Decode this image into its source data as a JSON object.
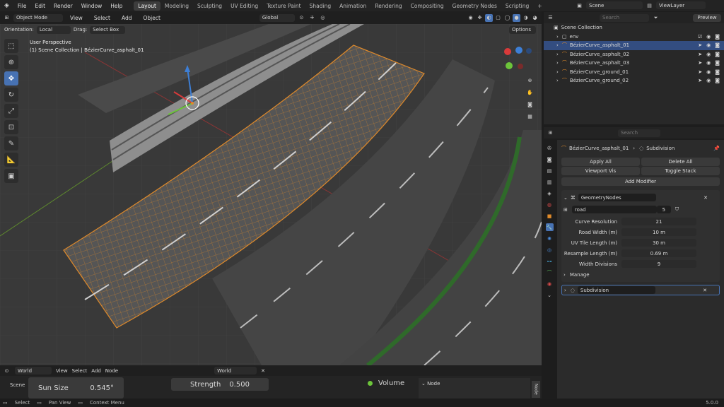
{
  "menu": {
    "file": "File",
    "edit": "Edit",
    "render": "Render",
    "window": "Window",
    "help": "Help"
  },
  "workspaces": [
    "Layout",
    "Modeling",
    "Sculpting",
    "UV Editing",
    "Texture Paint",
    "Shading",
    "Animation",
    "Rendering",
    "Compositing",
    "Geometry Nodes",
    "Scripting"
  ],
  "top_right": {
    "scene": "Scene",
    "view_layer": "ViewLayer"
  },
  "viewport_header": {
    "mode": "Object Mode",
    "view": "View",
    "select": "Select",
    "add": "Add",
    "object": "Object",
    "transform": "Global"
  },
  "sub_header": {
    "orientation_label": "Orientation:",
    "orientation": "Local",
    "drag_label": "Drag:",
    "drag": "Select Box",
    "options": "Options"
  },
  "overlay": {
    "perspective": "User Perspective",
    "collection": "(1) Scene Collection | BézierCurve_asphalt_01"
  },
  "outliner": {
    "search_placeholder": "Search",
    "preview": "Preview",
    "root": "Scene Collection",
    "items": [
      {
        "name": "env",
        "selected": false
      },
      {
        "name": "BézierCurve_asphalt_01",
        "selected": true
      },
      {
        "name": "BézierCurve_asphalt_02",
        "selected": false
      },
      {
        "name": "BézierCurve_asphalt_03",
        "selected": false
      },
      {
        "name": "BézierCurve_ground_01",
        "selected": false
      },
      {
        "name": "BézierCurve_ground_02",
        "selected": false
      }
    ]
  },
  "properties": {
    "search_placeholder": "Search",
    "object_name": "BézierCurve_asphalt_01",
    "tab": "Subdivision",
    "apply_all": "Apply All",
    "delete_all": "Delete All",
    "viewport_vis": "Viewport Vis",
    "toggle_stack": "Toggle Stack",
    "add_modifier": "Add Modifier",
    "gn_modifier": "GeometryNodes",
    "node_group": "road",
    "node_group_users": "5",
    "params": [
      {
        "label": "Curve Resolution",
        "value": "21"
      },
      {
        "label": "Road Width (m)",
        "value": "10 m"
      },
      {
        "label": "UV Tile Length (m)",
        "value": "30 m"
      },
      {
        "label": "Resample Length (m)",
        "value": "0.69 m"
      },
      {
        "label": "Width Divisions",
        "value": "9"
      }
    ],
    "manage": "Manage",
    "subdivision_modifier": "Subdivision"
  },
  "bottom_editor": {
    "world_type": "World",
    "view": "View",
    "select": "Select",
    "add": "Add",
    "node": "Node",
    "world_name": "World",
    "scene_label": "Scene",
    "sun_size_label": "Sun Size",
    "sun_size_value": "0.545°",
    "world_label": "World",
    "strength_label": "Strength",
    "strength_value": "0.500",
    "volume_label": "Volume",
    "node_panel": "Node",
    "node_tab": "Node"
  },
  "statusbar": {
    "select": "Select",
    "pan": "Pan View",
    "context": "Context Menu",
    "version": "5.0.0"
  },
  "colors": {
    "accent": "#4772b3",
    "selection": "#334d80",
    "wire_orange": "#e08a2a",
    "grass": "#2f6a2a"
  }
}
